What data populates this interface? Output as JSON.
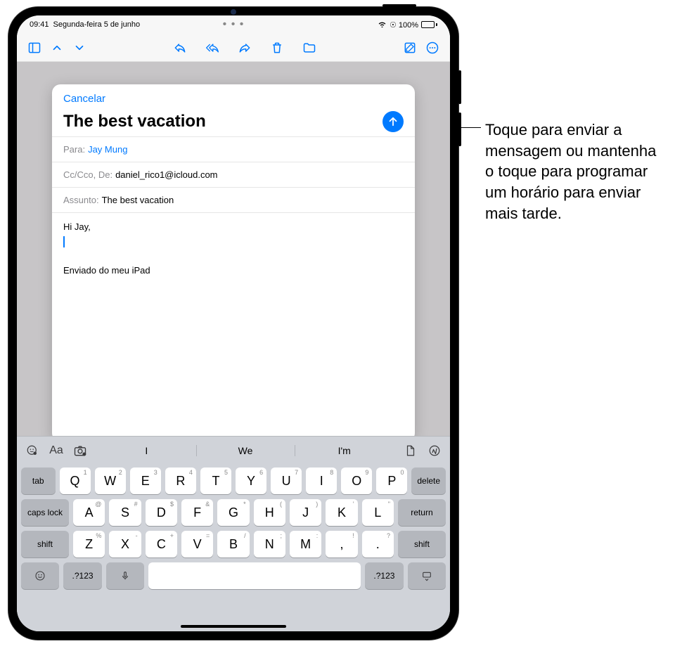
{
  "status": {
    "time": "09:41",
    "date": "Segunda-feira 5 de junho",
    "battery": "100%"
  },
  "toolbar": {
    "sidebar": "sidebar",
    "up": "up",
    "down": "down",
    "reply": "reply",
    "replyall": "replyall",
    "forward": "forward",
    "trash": "trash",
    "folder": "folder",
    "compose": "compose",
    "more": "more"
  },
  "compose": {
    "cancel": "Cancelar",
    "title": "The best vacation",
    "to_label": "Para:",
    "to_value": "Jay Mung",
    "cc_label": "Cc/Cco, De:",
    "cc_value": "daniel_rico1@icloud.com",
    "subject_label": "Assunto:",
    "subject_value": "The best vacation",
    "body_greeting": "Hi Jay,",
    "signature": "Enviado do meu iPad"
  },
  "callout": "Toque para enviar a mensagem ou mantenha o toque para programar um horário para enviar mais tarde.",
  "kb": {
    "suggestions": [
      "I",
      "We",
      "I'm"
    ],
    "row1": [
      {
        "k": "Q",
        "a": "1"
      },
      {
        "k": "W",
        "a": "2"
      },
      {
        "k": "E",
        "a": "3"
      },
      {
        "k": "R",
        "a": "4"
      },
      {
        "k": "T",
        "a": "5"
      },
      {
        "k": "Y",
        "a": "6"
      },
      {
        "k": "U",
        "a": "7"
      },
      {
        "k": "I",
        "a": "8"
      },
      {
        "k": "O",
        "a": "9"
      },
      {
        "k": "P",
        "a": "0"
      }
    ],
    "row2": [
      {
        "k": "A",
        "a": "@"
      },
      {
        "k": "S",
        "a": "#"
      },
      {
        "k": "D",
        "a": "$"
      },
      {
        "k": "F",
        "a": "&"
      },
      {
        "k": "G",
        "a": "*"
      },
      {
        "k": "H",
        "a": "("
      },
      {
        "k": "J",
        "a": ")"
      },
      {
        "k": "K",
        "a": "'"
      },
      {
        "k": "L",
        "a": "\""
      }
    ],
    "row3": [
      {
        "k": "Z",
        "a": "%"
      },
      {
        "k": "X",
        "a": "-"
      },
      {
        "k": "C",
        "a": "+"
      },
      {
        "k": "V",
        "a": "="
      },
      {
        "k": "B",
        "a": "/"
      },
      {
        "k": "N",
        "a": ";"
      },
      {
        "k": "M",
        "a": ":"
      },
      {
        "k": ",",
        "a": "!"
      },
      {
        "k": ".",
        "a": "?"
      }
    ],
    "tab": "tab",
    "delete": "delete",
    "caps": "caps lock",
    "return": "return",
    "shift": "shift",
    "sym": ".?123"
  }
}
